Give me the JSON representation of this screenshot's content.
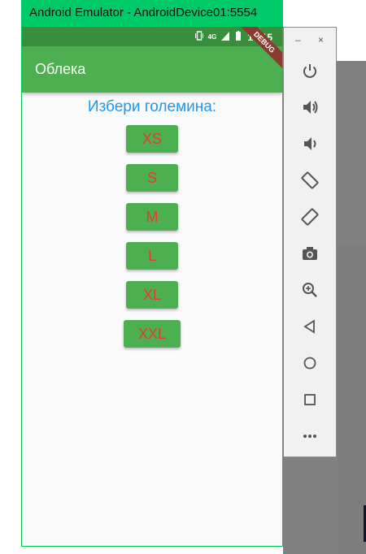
{
  "window": {
    "title": "Android Emulator - AndroidDevice01:5554"
  },
  "status_bar": {
    "time": "10:15",
    "network": "4G",
    "debug_banner": "DEBUG"
  },
  "app_bar": {
    "title": "Облека"
  },
  "content": {
    "prompt": "Избери големина:",
    "sizes": [
      "XS",
      "S",
      "M",
      "L",
      "XL",
      "XXL"
    ]
  },
  "toolbar": {
    "minimize": "–",
    "close": "×",
    "buttons": [
      "power-icon",
      "volume-up-icon",
      "volume-down-icon",
      "rotate-left-icon",
      "rotate-right-icon",
      "camera-icon",
      "zoom-icon",
      "back-icon",
      "home-icon",
      "overview-icon",
      "more-icon"
    ]
  },
  "colors": {
    "title_bar": "#00c96a",
    "status_bar": "#388e3c",
    "app_bar": "#4caf50",
    "button_bg": "#4caf50",
    "button_text": "#e53935",
    "prompt_text": "#2196f3"
  }
}
